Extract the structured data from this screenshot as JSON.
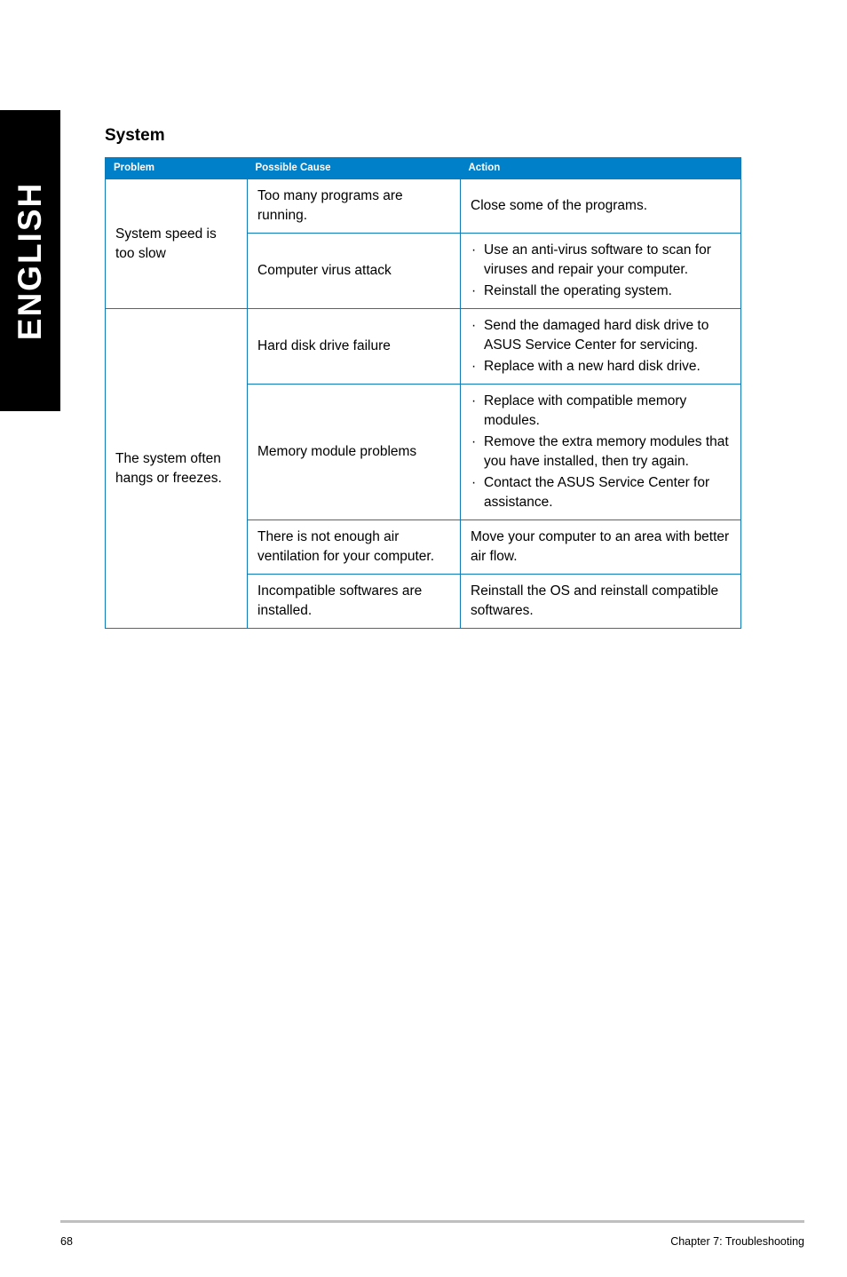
{
  "language_tab": {
    "label": "ENGLISH"
  },
  "section": {
    "title": "System"
  },
  "table": {
    "headers": [
      "Problem",
      "Possible Cause",
      "Action"
    ],
    "rows": [
      {
        "problem": "System speed is too slow",
        "problem_rowspan": 2,
        "causes": [
          {
            "cause": "Too many programs are running.",
            "actions": [
              "Close some of the programs."
            ],
            "bulleted": false
          },
          {
            "cause": "Computer virus attack",
            "actions": [
              "Use an anti-virus software to scan for viruses and repair your computer.",
              "Reinstall the operating system."
            ],
            "bulleted": true
          }
        ]
      },
      {
        "problem": "The system often hangs or freezes.",
        "problem_rowspan": 4,
        "causes": [
          {
            "cause": "Hard disk drive failure",
            "actions": [
              "Send the damaged hard disk drive to ASUS Service Center for servicing.",
              "Replace with a new hard disk drive."
            ],
            "bulleted": true
          },
          {
            "cause": "Memory module problems",
            "actions": [
              "Replace with compatible memory modules.",
              "Remove the extra memory modules that you have installed, then try again.",
              "Contact the ASUS Service Center for assistance."
            ],
            "bulleted": true
          },
          {
            "cause": "There is not enough air ventilation for your computer.",
            "actions": [
              "Move your computer to an area with better air flow."
            ],
            "bulleted": false
          },
          {
            "cause": "Incompatible softwares are installed.",
            "actions": [
              "Reinstall the OS and reinstall compatible softwares."
            ],
            "bulleted": false
          }
        ]
      }
    ]
  },
  "footer": {
    "page_number": "68",
    "chapter": "Chapter 7: Troubleshooting"
  },
  "colors": {
    "header_blue": "#0080c8",
    "border_blue": "#0e7ab8",
    "tab_black": "#000000",
    "footer_rule": "#bfbfbf"
  },
  "bullet_glyph": "·"
}
